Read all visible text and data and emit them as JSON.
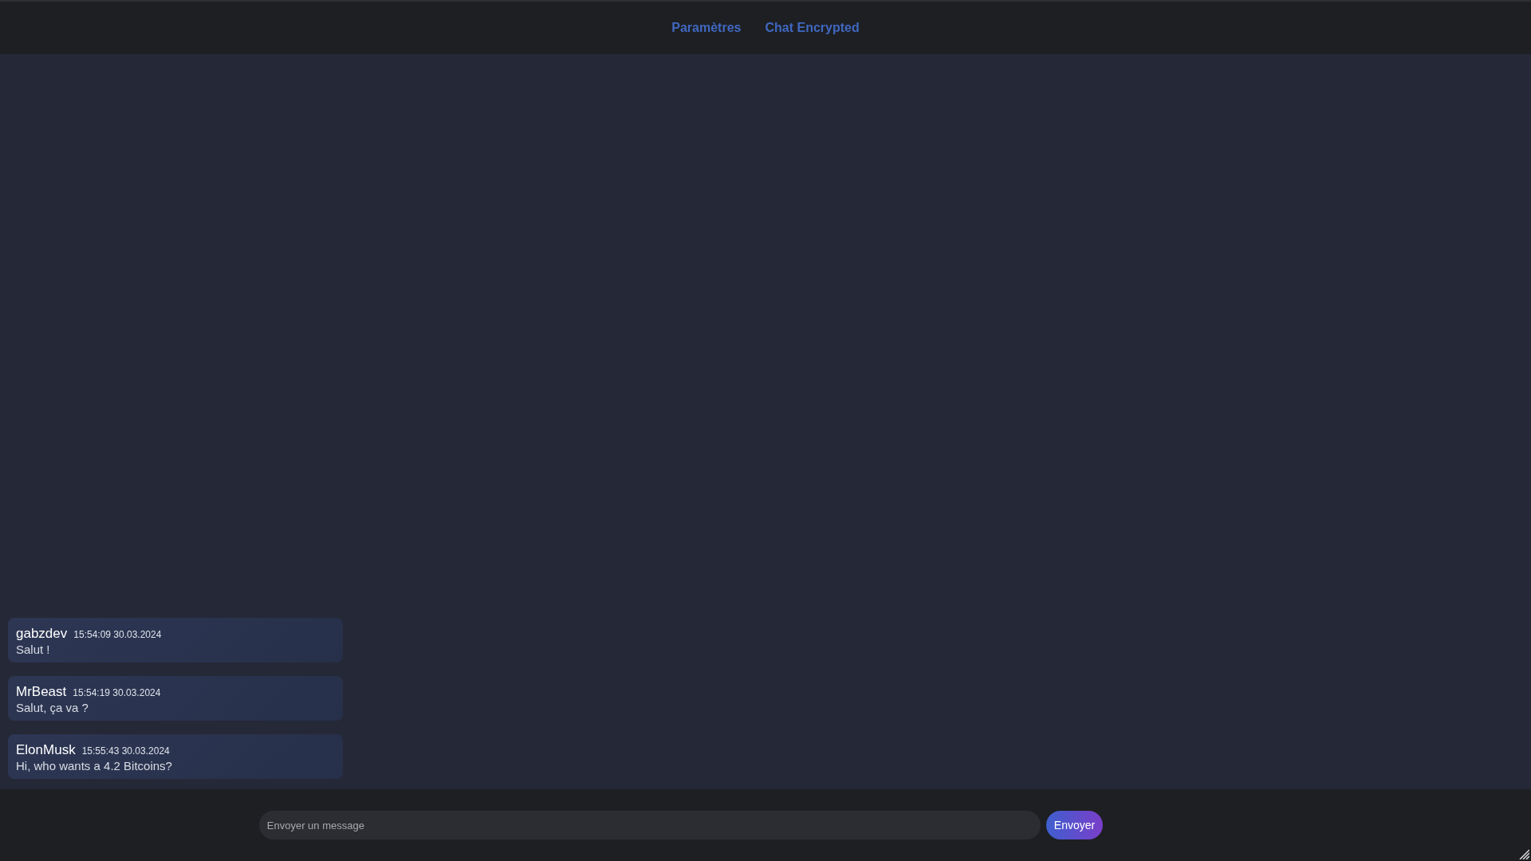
{
  "nav": [
    {
      "label": "Paramètres"
    },
    {
      "label": "Chat Encrypted"
    }
  ],
  "messages": [
    {
      "author": "gabzdev",
      "time": "15:54:09 30.03.2024",
      "text": "Salut !"
    },
    {
      "author": "MrBeast",
      "time": "15:54:19 30.03.2024",
      "text": "Salut, ça va ?"
    },
    {
      "author": "ElonMusk",
      "time": "15:55:43 30.03.2024",
      "text": "Hi, who wants a 4.2 Bitcoins?"
    }
  ],
  "composer": {
    "placeholder": "Envoyer un message",
    "button": "Envoyer"
  }
}
